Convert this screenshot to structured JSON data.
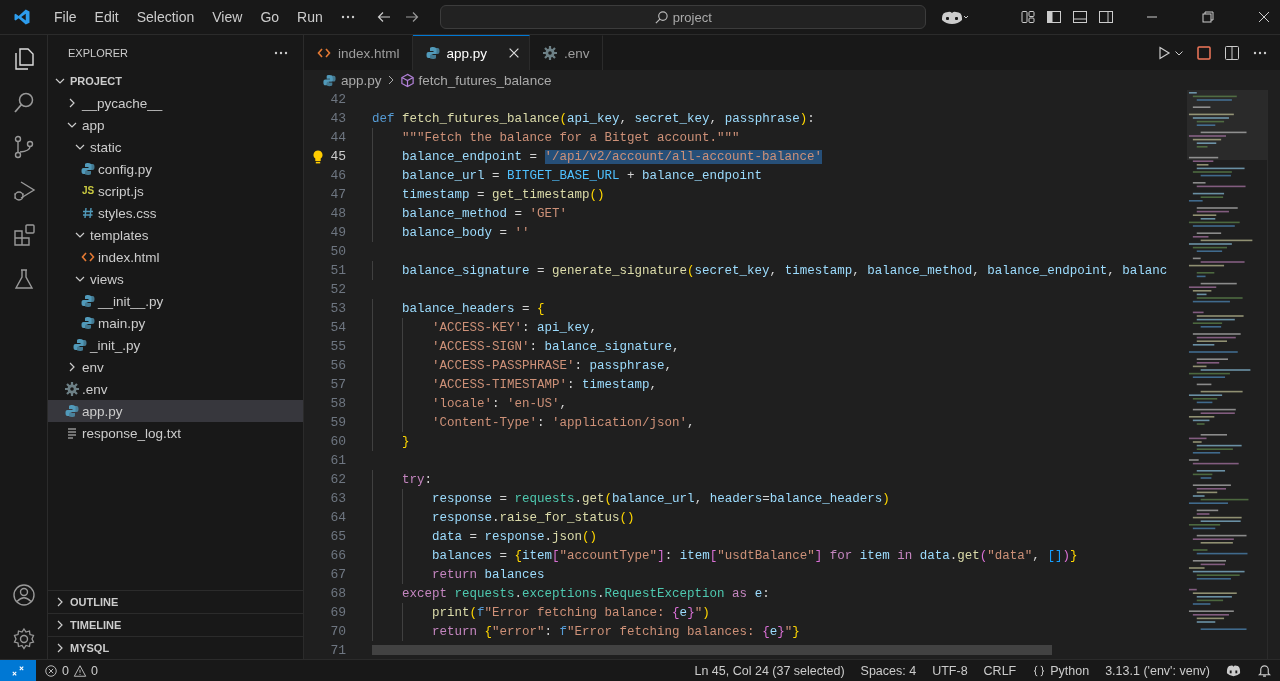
{
  "menu": [
    "File",
    "Edit",
    "Selection",
    "View",
    "Go",
    "Run"
  ],
  "search": {
    "value": "project"
  },
  "sidebar": {
    "title": "EXPLORER",
    "folder": {
      "label": "PROJECT",
      "expanded": true
    },
    "tree": [
      {
        "label": "__pycache__",
        "kind": "folder",
        "expanded": false,
        "selected": false
      },
      {
        "label": "app",
        "kind": "folder",
        "expanded": true,
        "selected": false,
        "children": [
          {
            "label": "static",
            "kind": "folder",
            "expanded": true,
            "selected": false,
            "children": [
              {
                "label": "config.py",
                "kind": "python",
                "selected": false
              },
              {
                "label": "script.js",
                "kind": "js",
                "icon_text": "JS",
                "selected": false
              },
              {
                "label": "styles.css",
                "kind": "css",
                "selected": false
              }
            ]
          },
          {
            "label": "templates",
            "kind": "folder",
            "expanded": true,
            "selected": false,
            "children": [
              {
                "label": "index.html",
                "kind": "html",
                "selected": false
              }
            ]
          },
          {
            "label": "views",
            "kind": "folder",
            "expanded": true,
            "selected": false,
            "children": [
              {
                "label": "__init__.py",
                "kind": "python",
                "selected": false
              },
              {
                "label": "main.py",
                "kind": "python",
                "selected": false
              }
            ]
          },
          {
            "label": "_init_.py",
            "kind": "python",
            "selected": false
          }
        ]
      },
      {
        "label": "env",
        "kind": "folder",
        "expanded": false,
        "selected": false
      },
      {
        "label": ".env",
        "kind": "gear",
        "selected": false
      },
      {
        "label": "app.py",
        "kind": "python",
        "selected": true
      },
      {
        "label": "response_log.txt",
        "kind": "text",
        "selected": false
      }
    ],
    "panels": [
      {
        "label": "OUTLINE",
        "expanded": false
      },
      {
        "label": "TIMELINE",
        "expanded": false
      },
      {
        "label": "MYSQL",
        "expanded": false
      }
    ]
  },
  "tabs": [
    {
      "label": "index.html",
      "kind": "html",
      "selected": false
    },
    {
      "label": "app.py",
      "kind": "python",
      "selected": true
    },
    {
      "label": ".env",
      "kind": "gear",
      "selected": false
    }
  ],
  "breadcrumbs": [
    {
      "label": "app.py",
      "kind": "python"
    },
    {
      "label": "fetch_futures_balance",
      "kind": "function"
    }
  ],
  "code": [
    {
      "number": "42",
      "current": false
    },
    {
      "number": "43",
      "current": false,
      "tokens": [
        {
          "text": "def ",
          "kind": "keyword"
        },
        {
          "text": "fetch_futures_balance",
          "kind": "function"
        },
        {
          "text": "(",
          "kind": "bracket1"
        },
        {
          "text": "api_key",
          "kind": "variable"
        },
        {
          "text": ", ",
          "kind": "plain"
        },
        {
          "text": "secret_key",
          "kind": "variable"
        },
        {
          "text": ", ",
          "kind": "plain"
        },
        {
          "text": "passphrase",
          "kind": "variable"
        },
        {
          "text": ")",
          "kind": "bracket1"
        },
        {
          "text": ":",
          "kind": "plain"
        }
      ]
    },
    {
      "number": "44",
      "current": false,
      "tokens": [
        {
          "text": "    \"\"\"Fetch the balance for a Bitget account.\"\"\"",
          "kind": "string"
        }
      ]
    },
    {
      "number": "45",
      "current": true,
      "tokens": [
        {
          "text": "    balance_endpoint",
          "kind": "variable"
        },
        {
          "text": " = ",
          "kind": "plain"
        },
        {
          "text": "'/api/v2/account/all-account-balance'",
          "kind": "selected-string"
        }
      ]
    },
    {
      "number": "46",
      "current": false,
      "tokens": [
        {
          "text": "    balance_url",
          "kind": "variable"
        },
        {
          "text": " = ",
          "kind": "plain"
        },
        {
          "text": "BITGET_BASE_URL",
          "kind": "constant"
        },
        {
          "text": " + ",
          "kind": "plain"
        },
        {
          "text": "balance_endpoint",
          "kind": "variable"
        }
      ]
    },
    {
      "number": "47",
      "current": false,
      "tokens": [
        {
          "text": "    timestamp",
          "kind": "variable"
        },
        {
          "text": " = ",
          "kind": "plain"
        },
        {
          "text": "get_timestamp",
          "kind": "function"
        },
        {
          "text": "()",
          "kind": "bracket1"
        }
      ]
    },
    {
      "number": "48",
      "current": false,
      "tokens": [
        {
          "text": "    balance_method",
          "kind": "variable"
        },
        {
          "text": " = ",
          "kind": "plain"
        },
        {
          "text": "'GET'",
          "kind": "string"
        }
      ]
    },
    {
      "number": "49",
      "current": false,
      "tokens": [
        {
          "text": "    balance_body",
          "kind": "variable"
        },
        {
          "text": " = ",
          "kind": "plain"
        },
        {
          "text": "''",
          "kind": "string"
        }
      ]
    },
    {
      "number": "50",
      "current": false
    },
    {
      "number": "51",
      "current": false,
      "tokens": [
        {
          "text": "    balance_signature",
          "kind": "variable"
        },
        {
          "text": " = ",
          "kind": "plain"
        },
        {
          "text": "generate_signature",
          "kind": "function"
        },
        {
          "text": "(",
          "kind": "bracket1"
        },
        {
          "text": "secret_key",
          "kind": "variable"
        },
        {
          "text": ", ",
          "kind": "plain"
        },
        {
          "text": "timestamp",
          "kind": "variable"
        },
        {
          "text": ", ",
          "kind": "plain"
        },
        {
          "text": "balance_method",
          "kind": "variable"
        },
        {
          "text": ", ",
          "kind": "plain"
        },
        {
          "text": "balance_endpoint",
          "kind": "variable"
        },
        {
          "text": ", ",
          "kind": "plain"
        },
        {
          "text": "balanc",
          "kind": "variable"
        }
      ]
    },
    {
      "number": "52",
      "current": false
    },
    {
      "number": "53",
      "current": false,
      "tokens": [
        {
          "text": "    balance_headers",
          "kind": "variable"
        },
        {
          "text": " = ",
          "kind": "plain"
        },
        {
          "text": "{",
          "kind": "bracket1"
        }
      ]
    },
    {
      "number": "54",
      "current": false,
      "tokens": [
        {
          "text": "        'ACCESS-KEY'",
          "kind": "string"
        },
        {
          "text": ": ",
          "kind": "plain"
        },
        {
          "text": "api_key",
          "kind": "variable"
        },
        {
          "text": ",",
          "kind": "plain"
        }
      ]
    },
    {
      "number": "55",
      "current": false,
      "tokens": [
        {
          "text": "        'ACCESS-SIGN'",
          "kind": "string"
        },
        {
          "text": ": ",
          "kind": "plain"
        },
        {
          "text": "balance_signature",
          "kind": "variable"
        },
        {
          "text": ",",
          "kind": "plain"
        }
      ]
    },
    {
      "number": "56",
      "current": false,
      "tokens": [
        {
          "text": "        'ACCESS-PASSPHRASE'",
          "kind": "string"
        },
        {
          "text": ": ",
          "kind": "plain"
        },
        {
          "text": "passphrase",
          "kind": "variable"
        },
        {
          "text": ",",
          "kind": "plain"
        }
      ]
    },
    {
      "number": "57",
      "current": false,
      "tokens": [
        {
          "text": "        'ACCESS-TIMESTAMP'",
          "kind": "string"
        },
        {
          "text": ": ",
          "kind": "plain"
        },
        {
          "text": "timestamp",
          "kind": "variable"
        },
        {
          "text": ",",
          "kind": "plain"
        }
      ]
    },
    {
      "number": "58",
      "current": false,
      "tokens": [
        {
          "text": "        'locale'",
          "kind": "string"
        },
        {
          "text": ": ",
          "kind": "plain"
        },
        {
          "text": "'en-US'",
          "kind": "string"
        },
        {
          "text": ",",
          "kind": "plain"
        }
      ]
    },
    {
      "number": "59",
      "current": false,
      "tokens": [
        {
          "text": "        'Content-Type'",
          "kind": "string"
        },
        {
          "text": ": ",
          "kind": "plain"
        },
        {
          "text": "'application/json'",
          "kind": "string"
        },
        {
          "text": ",",
          "kind": "plain"
        }
      ]
    },
    {
      "number": "60",
      "current": false,
      "tokens": [
        {
          "text": "    }",
          "kind": "bracket1"
        }
      ]
    },
    {
      "number": "61",
      "current": false
    },
    {
      "number": "62",
      "current": false,
      "tokens": [
        {
          "text": "    try",
          "kind": "control"
        },
        {
          "text": ":",
          "kind": "plain"
        }
      ]
    },
    {
      "number": "63",
      "current": false,
      "tokens": [
        {
          "text": "        response",
          "kind": "variable"
        },
        {
          "text": " = ",
          "kind": "plain"
        },
        {
          "text": "requests",
          "kind": "class"
        },
        {
          "text": ".",
          "kind": "plain"
        },
        {
          "text": "get",
          "kind": "function"
        },
        {
          "text": "(",
          "kind": "bracket1"
        },
        {
          "text": "balance_url",
          "kind": "variable"
        },
        {
          "text": ", ",
          "kind": "plain"
        },
        {
          "text": "headers",
          "kind": "variable"
        },
        {
          "text": "=",
          "kind": "plain"
        },
        {
          "text": "balance_headers",
          "kind": "variable"
        },
        {
          "text": ")",
          "kind": "bracket1"
        }
      ]
    },
    {
      "number": "64",
      "current": false,
      "tokens": [
        {
          "text": "        response",
          "kind": "variable"
        },
        {
          "text": ".",
          "kind": "plain"
        },
        {
          "text": "raise_for_status",
          "kind": "function"
        },
        {
          "text": "()",
          "kind": "bracket1"
        }
      ]
    },
    {
      "number": "65",
      "current": false,
      "tokens": [
        {
          "text": "        data",
          "kind": "variable"
        },
        {
          "text": " = ",
          "kind": "plain"
        },
        {
          "text": "response",
          "kind": "variable"
        },
        {
          "text": ".",
          "kind": "plain"
        },
        {
          "text": "json",
          "kind": "function"
        },
        {
          "text": "()",
          "kind": "bracket1"
        }
      ]
    },
    {
      "number": "66",
      "current": false,
      "tokens": [
        {
          "text": "        balances",
          "kind": "variable"
        },
        {
          "text": " = ",
          "kind": "plain"
        },
        {
          "text": "{",
          "kind": "bracket1"
        },
        {
          "text": "item",
          "kind": "variable"
        },
        {
          "text": "[",
          "kind": "bracket2"
        },
        {
          "text": "\"accountType\"",
          "kind": "string"
        },
        {
          "text": "]",
          "kind": "bracket2"
        },
        {
          "text": ": ",
          "kind": "plain"
        },
        {
          "text": "item",
          "kind": "variable"
        },
        {
          "text": "[",
          "kind": "bracket2"
        },
        {
          "text": "\"usdtBalance\"",
          "kind": "string"
        },
        {
          "text": "]",
          "kind": "bracket2"
        },
        {
          "text": " for ",
          "kind": "control"
        },
        {
          "text": "item",
          "kind": "variable"
        },
        {
          "text": " in ",
          "kind": "control"
        },
        {
          "text": "data",
          "kind": "variable"
        },
        {
          "text": ".",
          "kind": "plain"
        },
        {
          "text": "get",
          "kind": "function"
        },
        {
          "text": "(",
          "kind": "bracket2"
        },
        {
          "text": "\"data\"",
          "kind": "string"
        },
        {
          "text": ", ",
          "kind": "plain"
        },
        {
          "text": "[]",
          "kind": "bracket3"
        },
        {
          "text": ")",
          "kind": "bracket2"
        },
        {
          "text": "}",
          "kind": "bracket1"
        }
      ]
    },
    {
      "number": "67",
      "current": false,
      "tokens": [
        {
          "text": "        return ",
          "kind": "control"
        },
        {
          "text": "balances",
          "kind": "variable"
        }
      ]
    },
    {
      "number": "68",
      "current": false,
      "tokens": [
        {
          "text": "    except ",
          "kind": "control"
        },
        {
          "text": "requests",
          "kind": "class"
        },
        {
          "text": ".",
          "kind": "plain"
        },
        {
          "text": "exceptions",
          "kind": "class"
        },
        {
          "text": ".",
          "kind": "plain"
        },
        {
          "text": "RequestException",
          "kind": "class"
        },
        {
          "text": " as ",
          "kind": "control"
        },
        {
          "text": "e",
          "kind": "variable"
        },
        {
          "text": ":",
          "kind": "plain"
        }
      ]
    },
    {
      "number": "69",
      "current": false,
      "tokens": [
        {
          "text": "        print",
          "kind": "function"
        },
        {
          "text": "(",
          "kind": "bracket1"
        },
        {
          "text": "f",
          "kind": "keyword"
        },
        {
          "text": "\"Error fetching balance: ",
          "kind": "string"
        },
        {
          "text": "{",
          "kind": "bracket2"
        },
        {
          "text": "e",
          "kind": "variable"
        },
        {
          "text": "}",
          "kind": "bracket2"
        },
        {
          "text": "\"",
          "kind": "string"
        },
        {
          "text": ")",
          "kind": "bracket1"
        }
      ]
    },
    {
      "number": "70",
      "current": false,
      "tokens": [
        {
          "text": "        return ",
          "kind": "control"
        },
        {
          "text": "{",
          "kind": "bracket1"
        },
        {
          "text": "\"error\"",
          "kind": "string"
        },
        {
          "text": ": ",
          "kind": "plain"
        },
        {
          "text": "f",
          "kind": "keyword"
        },
        {
          "text": "\"Error fetching balances: ",
          "kind": "string"
        },
        {
          "text": "{",
          "kind": "bracket2"
        },
        {
          "text": "e",
          "kind": "variable"
        },
        {
          "text": "}",
          "kind": "bracket2"
        },
        {
          "text": "\"",
          "kind": "string"
        },
        {
          "text": "}",
          "kind": "bracket1"
        }
      ]
    },
    {
      "number": "71",
      "current": false
    }
  ],
  "status_bar": {
    "errors": "0",
    "warnings": "0",
    "items": [
      {
        "text": "Ln 45, Col 24 (37 selected)",
        "kind": "text"
      },
      {
        "text": "Spaces: 4",
        "kind": "text"
      },
      {
        "text": "UTF-8",
        "kind": "text"
      },
      {
        "text": "CRLF",
        "kind": "text"
      },
      {
        "text": "Python",
        "kind": "language"
      },
      {
        "text": "3.13.1 ('env': venv)",
        "kind": "text"
      }
    ]
  }
}
